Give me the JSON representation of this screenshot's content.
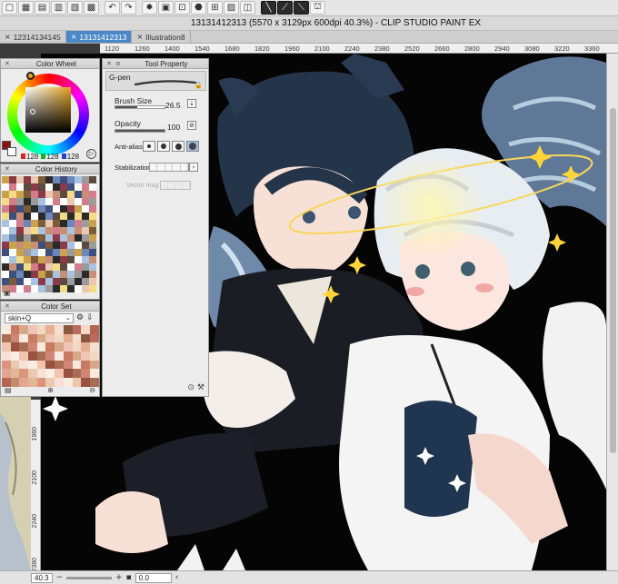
{
  "toolbar": {
    "buttons": [
      "app-icon",
      "new-icon",
      "open-icon",
      "save-icon",
      "save-as-icon",
      "export-icon",
      "undo-icon",
      "redo-icon",
      "brush-icon",
      "clear-icon",
      "crop-icon",
      "fill-icon",
      "transform-icon",
      "snap-icon",
      "ruler-icon",
      "pen-icon",
      "pen-alt-icon",
      "pen-alt2-icon",
      "hat-icon"
    ],
    "glyphs": [
      "▢",
      "▦",
      "▤",
      "▥",
      "▧",
      "▩",
      "↶",
      "↷",
      "✹",
      "▣",
      "⊡",
      "⬣",
      "⊞",
      "▨",
      "◫",
      "╲",
      "⟋",
      "⟍",
      "⛫"
    ]
  },
  "window": {
    "title": "13131412313 (5570 x 3129px 600dpi 40.3%) - CLIP STUDIO PAINT EX"
  },
  "tabs": [
    {
      "label": "12314134145",
      "active": false
    },
    {
      "label": "13131412313",
      "active": true
    },
    {
      "label": "Illustration8",
      "active": false
    }
  ],
  "ruler_h": [
    "1120",
    "1260",
    "1400",
    "1540",
    "1680",
    "1820",
    "1960",
    "2100",
    "2240",
    "2380",
    "2520",
    "2660",
    "2800",
    "2940",
    "3080",
    "3220",
    "3360"
  ],
  "ruler_v": [
    "1960",
    "2100",
    "2240",
    "2380"
  ],
  "color_wheel": {
    "title": "Color Wheel",
    "main_color": "#e6a224",
    "sub_color": "#ffffff",
    "r": "128",
    "g": "128",
    "b": "128"
  },
  "color_history": {
    "title": "Color History"
  },
  "color_set": {
    "title": "Color Set",
    "selected": "skin+Q"
  },
  "tool_property": {
    "title": "Tool Property",
    "tool_name": "G-pen",
    "brush_size_label": "Brush Size",
    "brush_size_value": "26.5",
    "brush_size_fill": 0.45,
    "opacity_label": "Opacity",
    "opacity_value": "100",
    "opacity_fill": 1.0,
    "antialias_label": "Anti-alias",
    "stabilization_label": "Stabilization",
    "vector_magnet_label": "Vector mag"
  },
  "status": {
    "zoom": "40.3",
    "angle": "0.0"
  },
  "palette_colors": [
    "#2a2a2a",
    "#ffffff",
    "#e9c7b0",
    "#c78f76",
    "#d27c8c",
    "#8b3a4a",
    "#3d4f7c",
    "#6d86b8",
    "#a9c2e0",
    "#f2dd86",
    "#c9a24b",
    "#7b5b3a",
    "#5a4a40",
    "#9b9b9b"
  ],
  "accent": "#4a88c7"
}
